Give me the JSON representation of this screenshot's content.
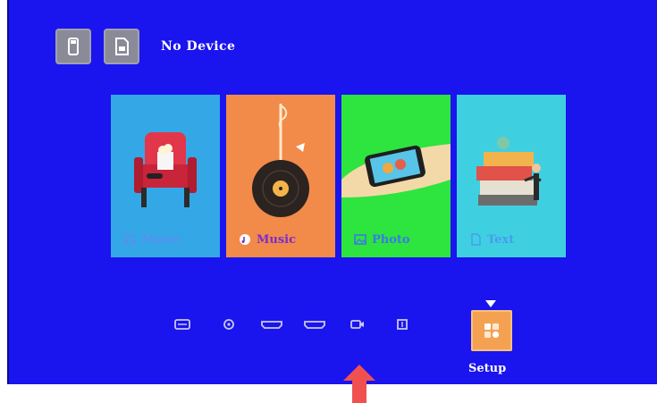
{
  "status": {
    "device_text": "No Device"
  },
  "device_icons": [
    {
      "name": "usb-drive-icon"
    },
    {
      "name": "sd-card-icon"
    }
  ],
  "tiles": [
    {
      "id": "movie",
      "label": "Movie",
      "color": "#34a8e6",
      "label_color": "#5a8ef0",
      "icon": "film-reel-icon",
      "selected": false
    },
    {
      "id": "music",
      "label": "Music",
      "color": "#f28a4a",
      "label_color": "#7a2dc9",
      "icon": "music-note-icon",
      "selected": false
    },
    {
      "id": "photo",
      "label": "Photo",
      "color": "#2ee43e",
      "label_color": "#3a7ae8",
      "icon": "image-icon",
      "selected": false
    },
    {
      "id": "text",
      "label": "Text",
      "color": "#3ed0e0",
      "label_color": "#4a9af0",
      "icon": "document-icon",
      "selected": false
    }
  ],
  "sources": [
    {
      "name": "card-source-icon"
    },
    {
      "name": "disc-source-icon"
    },
    {
      "name": "hdmi-1-source-icon"
    },
    {
      "name": "hdmi-2-source-icon"
    },
    {
      "name": "camera-source-icon"
    },
    {
      "name": "display-source-icon"
    }
  ],
  "setup": {
    "label": "Setup",
    "selected": true,
    "color": "#f4a252",
    "icon": "settings-grid-icon"
  },
  "annotation": {
    "arrow": "red-up-arrow",
    "color": "#f05050"
  }
}
